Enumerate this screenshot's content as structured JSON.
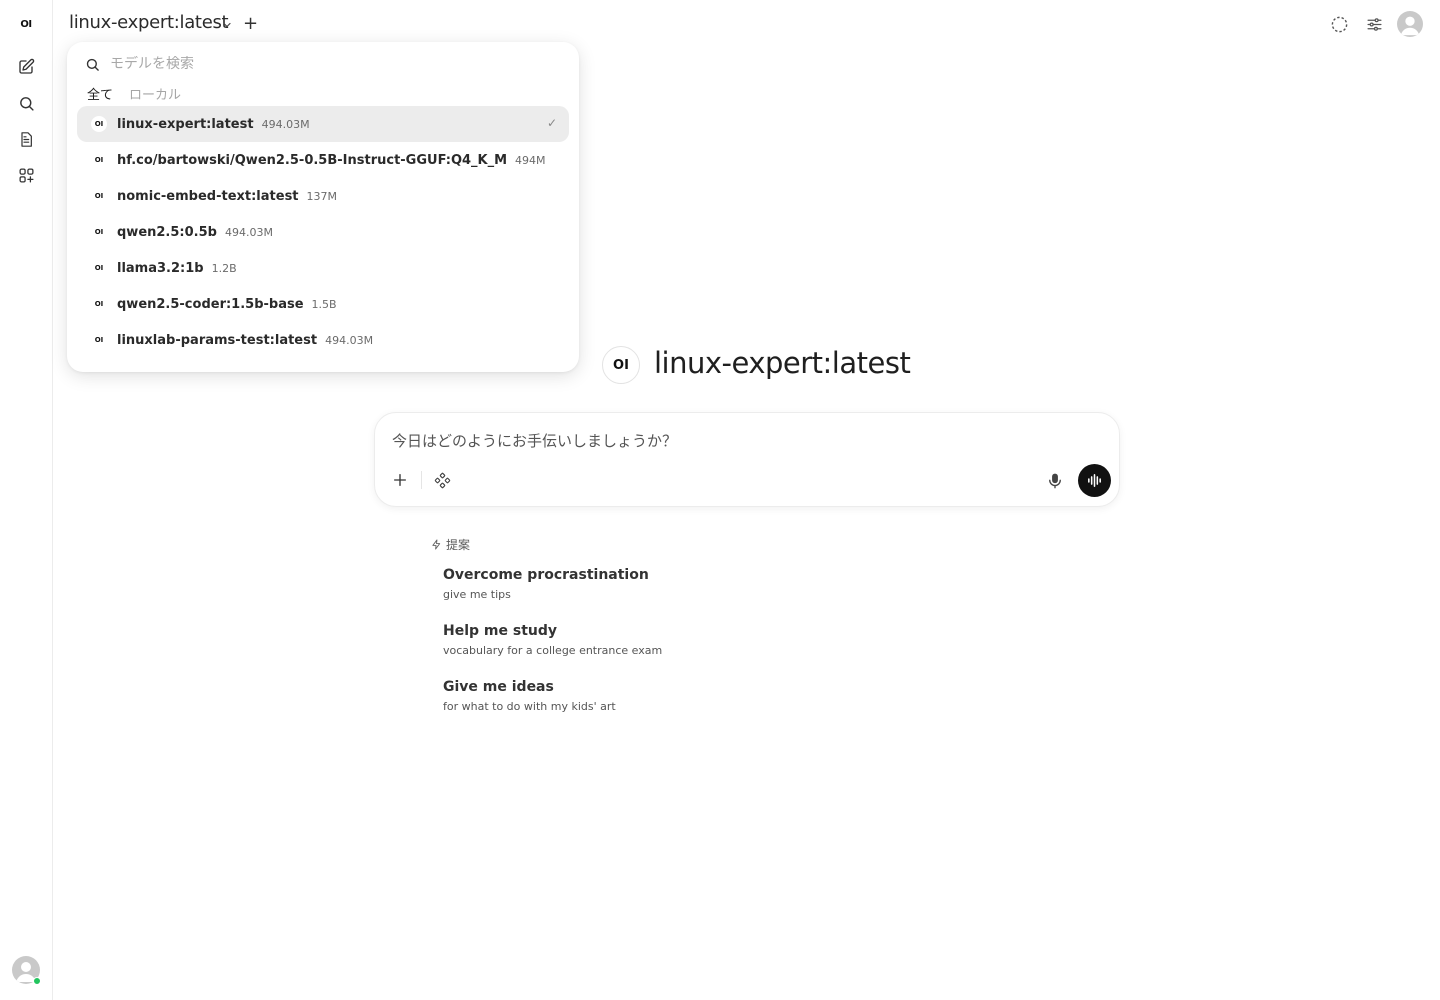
{
  "app": {
    "logo_text": "OI",
    "current_model": "linux-expert:latest"
  },
  "header": {
    "model_title": "linux-expert:latest",
    "add_label": "+"
  },
  "model_selector": {
    "search_placeholder": "モデルを検索",
    "tabs": [
      {
        "label": "全て",
        "active": true
      },
      {
        "label": "ローカル",
        "active": false
      }
    ],
    "items": [
      {
        "name": "linux-expert:latest",
        "size": "494.03M",
        "selected": true
      },
      {
        "name": "hf.co/bartowski/Qwen2.5-0.5B-Instruct-GGUF:Q4_K_M",
        "size": "494M",
        "selected": false
      },
      {
        "name": "nomic-embed-text:latest",
        "size": "137M",
        "selected": false
      },
      {
        "name": "qwen2.5:0.5b",
        "size": "494.03M",
        "selected": false
      },
      {
        "name": "llama3.2:1b",
        "size": "1.2B",
        "selected": false
      },
      {
        "name": "qwen2.5-coder:1.5b-base",
        "size": "1.5B",
        "selected": false
      },
      {
        "name": "linuxlab-params-test:latest",
        "size": "494.03M",
        "selected": false
      }
    ],
    "check_mark": "✓"
  },
  "main": {
    "model_heading": "linux-expert:latest",
    "input_placeholder": "今日はどのようにお手伝いしましょうか？",
    "suggestions_label": "提案",
    "suggestions": [
      {
        "title": "Overcome procrastination",
        "subtitle": "give me tips"
      },
      {
        "title": "Help me study",
        "subtitle": "vocabulary for a college entrance exam"
      },
      {
        "title": "Give me ideas",
        "subtitle": "for what to do with my kids' art"
      }
    ]
  },
  "colors": {
    "accent_dark": "#111111",
    "online": "#22c55e",
    "selected_row": "#ececec"
  }
}
